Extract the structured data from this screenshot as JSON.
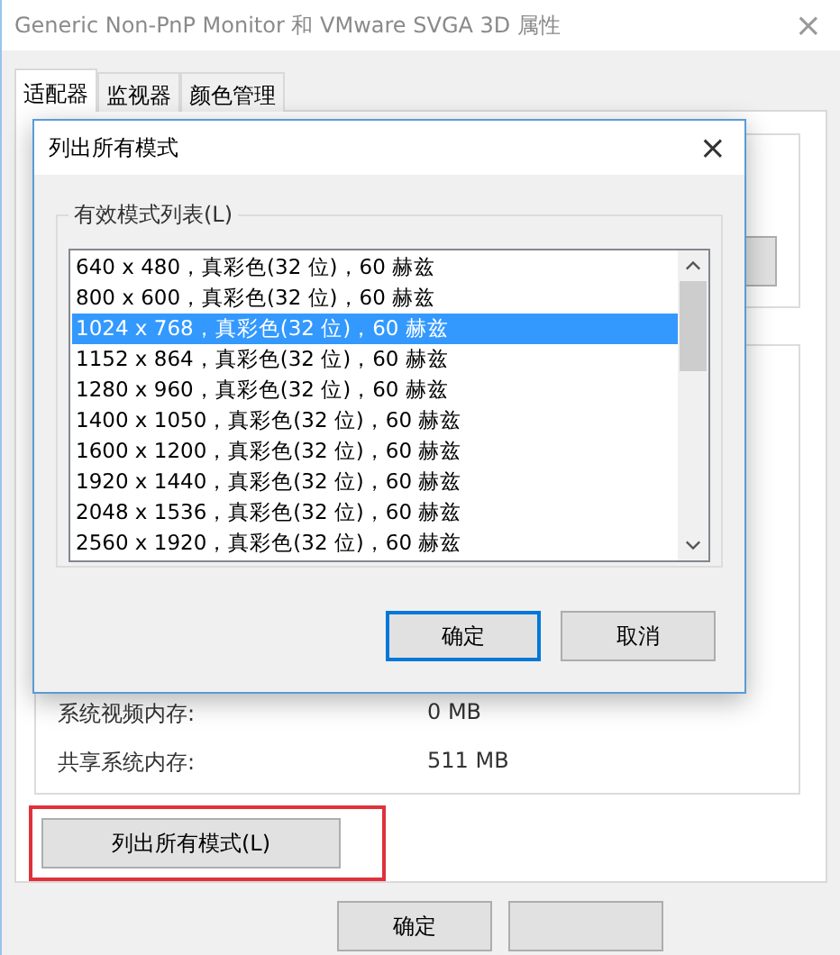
{
  "window": {
    "title": "Generic Non-PnP Monitor 和 VMware SVGA 3D 属性",
    "close": "×"
  },
  "tabs": [
    {
      "label": "适配器",
      "selected": true
    },
    {
      "label": "监视器",
      "selected": false
    },
    {
      "label": "颜色管理",
      "selected": false
    }
  ],
  "memory": [
    {
      "label": "系统视频内存:",
      "value": "0 MB"
    },
    {
      "label": "共享系统内存:",
      "value": "511 MB"
    }
  ],
  "list_modes_button": {
    "label": "列出所有模式(L)",
    "highlighted": true
  },
  "buttons": [
    {
      "kind": "labeled",
      "label": "确定"
    },
    {
      "kind": "covered"
    }
  ],
  "dialog": {
    "title": "列出所有模式",
    "close": "×",
    "group": "有效模式列表(L)",
    "modes": [
      {
        "label": "640 x 480，真彩色(32 位)，60 赫兹",
        "selected": false
      },
      {
        "label": "800 x 600，真彩色(32 位)，60 赫兹",
        "selected": false
      },
      {
        "label": "1024 x 768，真彩色(32 位)，60 赫兹",
        "selected": true
      },
      {
        "label": "1152 x 864，真彩色(32 位)，60 赫兹",
        "selected": false
      },
      {
        "label": "1280 x 960，真彩色(32 位)，60 赫兹",
        "selected": false
      },
      {
        "label": "1400 x 1050，真彩色(32 位)，60 赫兹",
        "selected": false
      },
      {
        "label": "1600 x 1200，真彩色(32 位)，60 赫兹",
        "selected": false
      },
      {
        "label": "1920 x 1440，真彩色(32 位)，60 赫兹",
        "selected": false
      },
      {
        "label": "2048 x 1536，真彩色(32 位)，60 赫兹",
        "selected": false
      },
      {
        "label": "2560 x 1920，真彩色(32 位)，60 赫兹",
        "selected": false
      }
    ],
    "buttons": [
      {
        "label": "确定",
        "default": true
      },
      {
        "label": "取消",
        "default": false
      }
    ]
  }
}
